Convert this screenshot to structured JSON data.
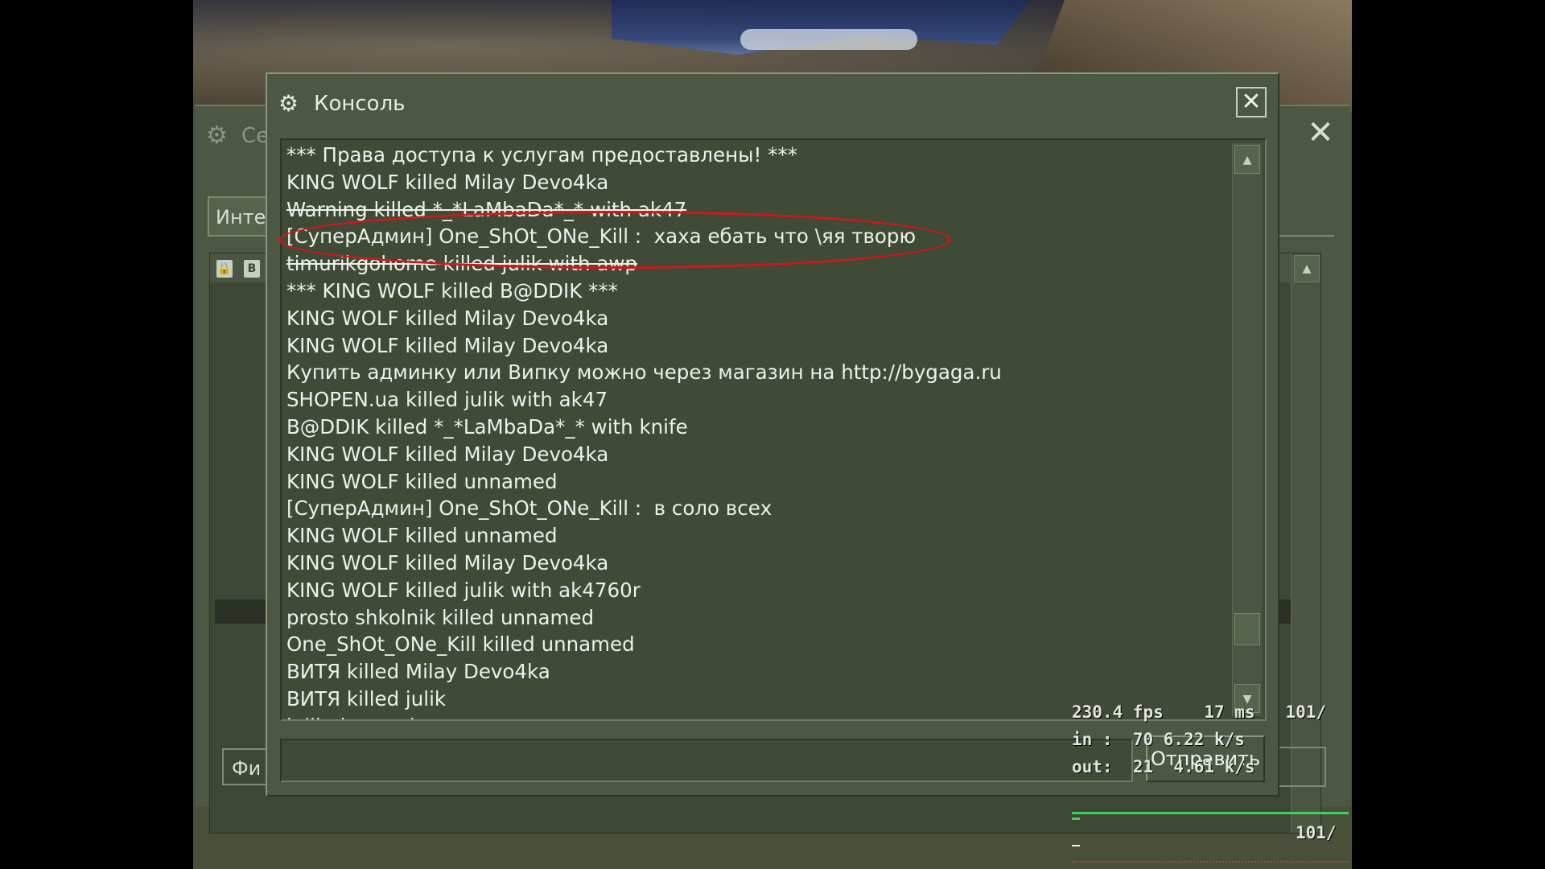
{
  "server_browser": {
    "title": "Се",
    "tab_label": "Инте",
    "filter_label": "Фи",
    "close_glyph": "✕",
    "column_icons": [
      "lock-icon",
      "vac-shield-icon"
    ],
    "column_icon_glyphs": [
      "🔒",
      "B"
    ],
    "scroll_up_glyph": "▲"
  },
  "console": {
    "title": "Консоль",
    "icon": "steam-icon",
    "close_glyph": "✕",
    "lines": [
      "*** Права доступа к услугам предоставлены! ***",
      "KING WOLF killed Milay Devo4ka",
      "Warning killed *_*LaMbaDa*_* with ak47",
      "[СуперАдмин] One_ShOt_ONe_Kill :  хаха ебать что \\яя творю",
      "timurikgohome killed julik with awp",
      "*** KING WOLF killed B@DDIK ***",
      "KING WOLF killed Milay Devo4ka",
      "KING WOLF killed Milay Devo4ka",
      "Купить админку или Випку можно через магазин на http://bygaga.ru",
      "SHOPEN.ua killed julik with ak47",
      "B@DDIK killed *_*LaMbaDa*_* with knife",
      "KING WOLF killed Milay Devo4ka",
      "KING WOLF killed unnamed",
      "[СуперАдмин] One_ShOt_ONe_Kill :  в соло всех",
      "KING WOLF killed unnamed",
      "KING WOLF killed Milay Devo4ka",
      "KING WOLF killed julik with ak4760r",
      "prosto shkolnik killed unnamed",
      "One_ShOt_ONe_Kill killed unnamed",
      "ВИТЯ killed Milay Devo4ka",
      "ВИТЯ killed julik",
      "julik dropped"
    ],
    "struck_lines": [
      2,
      4
    ],
    "highlighted_line": 3,
    "highlight_color": "#d8141a",
    "scroll_up_glyph": "▲",
    "scroll_down_glyph": "▼",
    "input_value": "",
    "send_label": "Отправить"
  },
  "netgraph": {
    "fps": "230.4 fps    17 ms   101/",
    "in": "in :  70 6.22 k/s",
    "out": "out:  21  4.61 k/s",
    "rate": "101/",
    "line_color": "#3fd25a"
  },
  "colors": {
    "window_bg": "#4c5844",
    "log_bg": "#3f4a37",
    "text": "#eef1ea"
  }
}
